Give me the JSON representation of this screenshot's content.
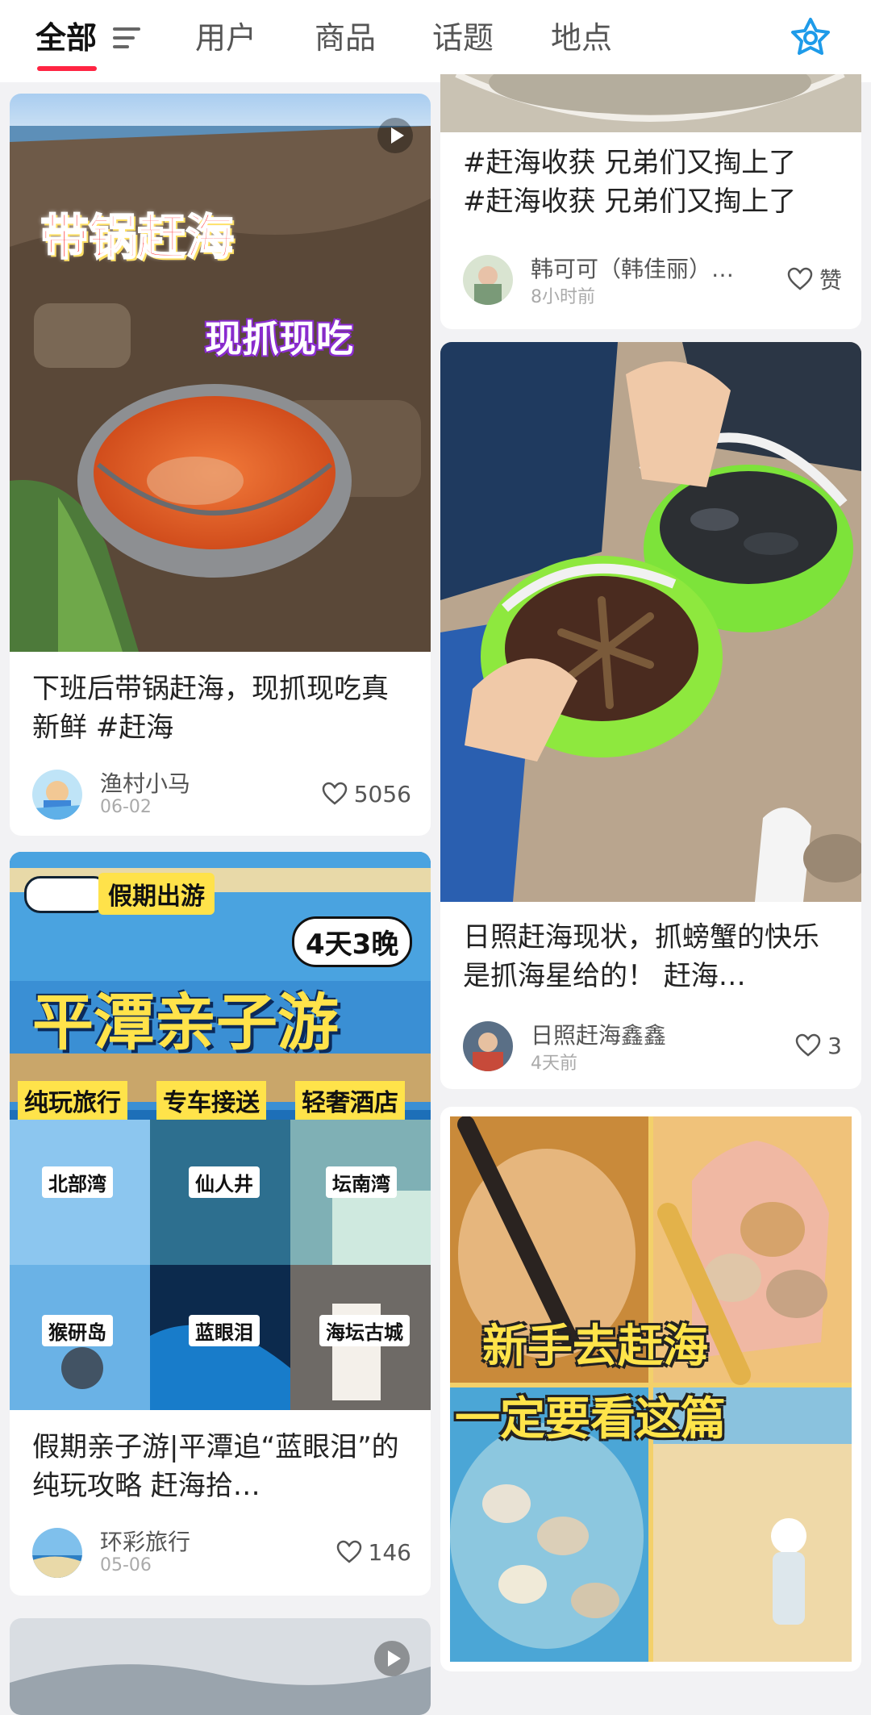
{
  "tabs": [
    "全部",
    "用户",
    "商品",
    "话题",
    "地点"
  ],
  "colors": {
    "accent": "#ff2442",
    "star_icon": "#1e9be9"
  },
  "left": {
    "card1": {
      "overlay_line1": "带锅赶海",
      "overlay_line2": "现抓现吃",
      "title": "下班后带锅赶海，现抓现吃真新鲜 #赶海",
      "author": "渔村小马",
      "date": "06-02",
      "likes": "5056"
    },
    "card2": {
      "badge": "假期出游",
      "bubble": "4天3晚",
      "headline": "平潭亲子游",
      "tags": [
        "纯玩旅行",
        "专车接送",
        "轻奢酒店"
      ],
      "spots": [
        "北部湾",
        "仙人井",
        "坛南湾",
        "猴研岛",
        "蓝眼泪",
        "海坛古城"
      ],
      "title": "假期亲子游|平潭追“蓝眼泪”的纯玩攻略 赶海拾…",
      "author": "环彩旅行",
      "date": "05-06",
      "likes": "146"
    }
  },
  "right": {
    "card1": {
      "title_line1": "#赶海收获 兄弟们又掏上了",
      "title_line2": "#赶海收获 兄弟们又掏上了",
      "author": "韩可可（韩佳丽）…",
      "date": "8小时前",
      "likes": "赞"
    },
    "card2": {
      "title": "日照赶海现状，抓螃蟹的快乐是抓海星给的！ 赶海…",
      "author": "日照赶海鑫鑫",
      "date": "4天前",
      "likes": "3"
    },
    "card3": {
      "overlay_line1": "新手去赶海",
      "overlay_line2": "一定要看这篇"
    }
  }
}
